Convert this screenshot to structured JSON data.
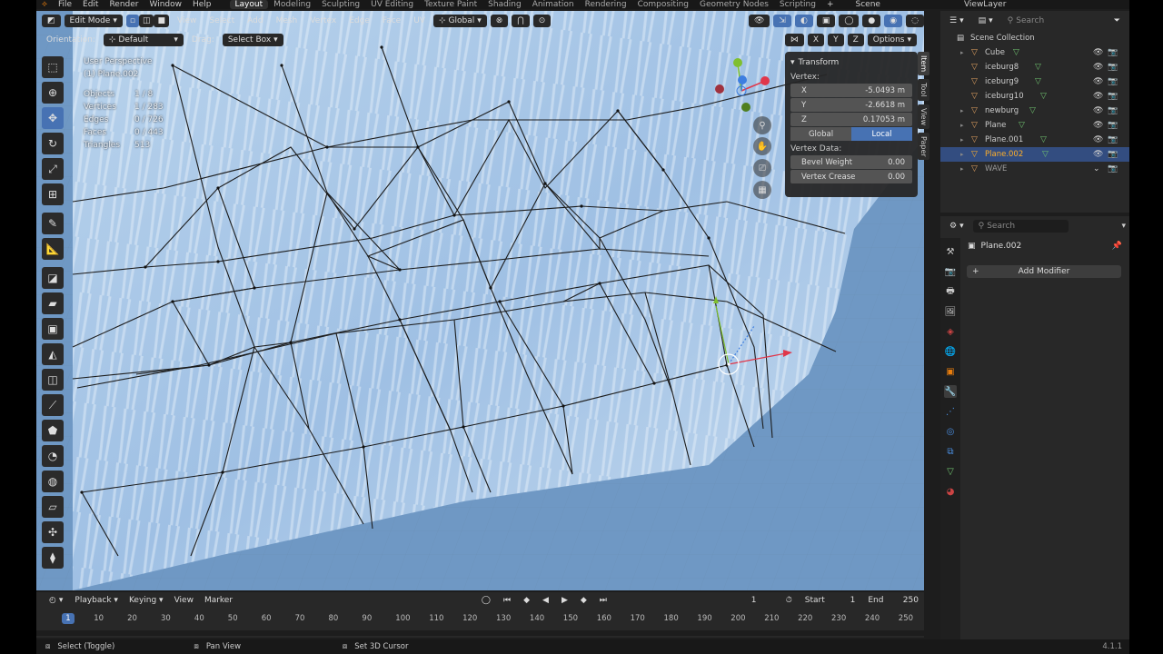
{
  "menu": {
    "logo": "⟡",
    "items": [
      "File",
      "Edit",
      "Render",
      "Window",
      "Help"
    ],
    "workspaces": [
      {
        "label": "Layout",
        "active": true
      },
      {
        "label": "Modeling",
        "active": false
      },
      {
        "label": "Sculpting",
        "active": false
      },
      {
        "label": "UV Editing",
        "active": false
      },
      {
        "label": "Texture Paint",
        "active": false
      },
      {
        "label": "Shading",
        "active": false
      },
      {
        "label": "Animation",
        "active": false
      },
      {
        "label": "Rendering",
        "active": false
      },
      {
        "label": "Compositing",
        "active": false
      },
      {
        "label": "Geometry Nodes",
        "active": false
      },
      {
        "label": "Scripting",
        "active": false
      }
    ],
    "add_tab": "+",
    "scene": "Scene",
    "view_layer": "ViewLayer"
  },
  "viewport_header": {
    "mode": "Edit Mode",
    "menus": [
      "View",
      "Select",
      "Add",
      "Mesh",
      "Vertex",
      "Edge",
      "Face",
      "UV"
    ],
    "transform_space": "Global",
    "orientation_label": "Orientation:",
    "orientation_value": "Default",
    "drag_label": "Drag:",
    "drag_value": "Select Box",
    "axis_x": "X",
    "axis_y": "Y",
    "axis_z": "Z",
    "options": "Options"
  },
  "overlay": {
    "view_name": "User Perspective",
    "object_name": "(1) Plane.002",
    "stats": [
      {
        "label": "Objects",
        "value": "1 / 8"
      },
      {
        "label": "Vertices",
        "value": "1 / 283"
      },
      {
        "label": "Edges",
        "value": "0 / 726"
      },
      {
        "label": "Faces",
        "value": "0 / 443"
      },
      {
        "label": "Triangles",
        "value": "513"
      }
    ]
  },
  "npanel": {
    "title": "Transform",
    "vertex_label": "Vertex:",
    "x_label": "X",
    "x_value": "-5.0493 m",
    "y_label": "Y",
    "y_value": "-2.6618 m",
    "z_label": "Z",
    "z_value": "0.17053 m",
    "global": "Global",
    "local": "Local",
    "vertex_data_label": "Vertex Data:",
    "bevel_label": "Bevel Weight",
    "bevel_value": "0.00",
    "crease_label": "Vertex Crease",
    "crease_value": "0.00",
    "tabs": [
      {
        "label": "Item",
        "active": true
      },
      {
        "label": "Tool",
        "active": false
      },
      {
        "label": "View",
        "active": false
      },
      {
        "label": "Paper",
        "active": false
      }
    ]
  },
  "outliner": {
    "search_placeholder": "Search",
    "root": "Scene Collection",
    "items": [
      {
        "name": "Cube",
        "selected": false,
        "expandable": true
      },
      {
        "name": "iceburg8",
        "selected": false,
        "expandable": false
      },
      {
        "name": "iceburg9",
        "selected": false,
        "expandable": false
      },
      {
        "name": "iceburg10",
        "selected": false,
        "expandable": false
      },
      {
        "name": "newburg",
        "selected": false,
        "expandable": true
      },
      {
        "name": "Plane",
        "selected": false,
        "expandable": true
      },
      {
        "name": "Plane.001",
        "selected": false,
        "expandable": true
      },
      {
        "name": "Plane.002",
        "selected": true,
        "expandable": true
      },
      {
        "name": "WAVE",
        "selected": false,
        "expandable": true
      }
    ]
  },
  "properties": {
    "search_placeholder": "Search",
    "object_name": "Plane.002",
    "add_modifier": "Add Modifier"
  },
  "timeline": {
    "menus": [
      "Playback",
      "Keying",
      "View",
      "Marker"
    ],
    "current_frame": "1",
    "start_label": "Start",
    "start_value": "1",
    "end_label": "End",
    "end_value": "250",
    "ticks": [
      "10",
      "20",
      "30",
      "40",
      "50",
      "60",
      "70",
      "80",
      "90",
      "100",
      "110",
      "120",
      "130",
      "140",
      "150",
      "160",
      "170",
      "180",
      "190",
      "200",
      "210",
      "220",
      "230",
      "240",
      "250"
    ],
    "playhead": "1"
  },
  "statusbar": {
    "select": "Select (Toggle)",
    "pan": "Pan View",
    "cursor": "Set 3D Cursor",
    "version": "4.1.1"
  },
  "colors": {
    "accent": "#4772b3",
    "selected_row": "#334d80",
    "viewport": "#3d5a7a",
    "mesh_icon": "#6fc26f",
    "x_axis": "#e0374a",
    "y_axis": "#7fbf2f",
    "z_axis": "#3d7ee0"
  }
}
